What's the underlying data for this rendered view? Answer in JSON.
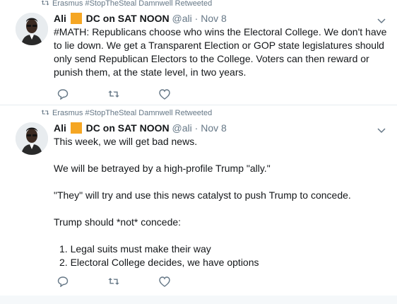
{
  "tweets": [
    {
      "retweet_context": "Erasmus #StopTheSteal Damnwell Retweeted",
      "name_part1": "Ali",
      "name_part2": "DC on SAT NOON",
      "handle": "@ali",
      "separator": "·",
      "date": "Nov 8",
      "text": "#MATH: Republicans choose who wins the Electoral College. We don't have to lie down. We get a Transparent Election or GOP state legislatures should only send Republican Electors to the College. Voters can then reward or punish them, at the state level, in two years."
    },
    {
      "retweet_context": "Erasmus #StopTheSteal Damnwell Retweeted",
      "name_part1": "Ali",
      "name_part2": "DC on SAT NOON",
      "handle": "@ali",
      "separator": "·",
      "date": "Nov 8",
      "line1": "This week, we will get bad news.",
      "line2": "We will be betrayed by a high-profile Trump \"ally.\"",
      "line3": "\"They\" will try and use this news catalyst to push Trump to concede.",
      "line4": "Trump should *not* concede:",
      "line5": "1. Legal suits must make their way",
      "line6": "2. Electoral College decides, we have options"
    }
  ],
  "colors": {
    "accent_orange": "#f5a623",
    "meta_gray": "#657786",
    "text": "#14171a",
    "divider": "#e6ecf0"
  },
  "icons": [
    "retweet-icon",
    "chevron-down-icon",
    "reply-icon",
    "retweet-icon",
    "like-icon"
  ]
}
